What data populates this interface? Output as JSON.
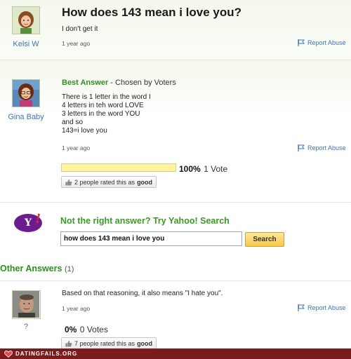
{
  "question": {
    "user": "Kelsi W",
    "title": "How does 143 mean i love you?",
    "body": "I don't get it",
    "time": "1 year ago",
    "report": "Report Abuse"
  },
  "best_answer": {
    "user": "Gina Baby",
    "label": "Best Answer",
    "chosen_by": " - Chosen by Voters",
    "lines": [
      "There is 1 letter in the word I",
      "4 letters in teh word LOVE",
      "3 letters in the word YOU",
      "and so",
      "143=i love you"
    ],
    "time": "1 year ago",
    "report": "Report Abuse",
    "vote_pct": "100%",
    "vote_fraction": 1.0,
    "vote_count": "1 Vote",
    "rated_prefix": "2 people rated this as",
    "rated_word": "good"
  },
  "yahoo": {
    "logo_text": "Y",
    "bang": "!",
    "prompt": "Not the right answer? Try Yahoo! Search",
    "search_value": "how does 143 mean i love you",
    "search_button": "Search"
  },
  "other_answers": {
    "heading": "Other Answers",
    "count": "(1)",
    "items": [
      {
        "user": "?",
        "body": "Based on that reasoning, it also means \"I hate you\".",
        "time": "1 year ago",
        "report": "Report Abuse",
        "vote_pct": "0%",
        "vote_count": "0 Votes",
        "rated_prefix": "7 people rated this as",
        "rated_word": "good"
      }
    ]
  },
  "footer": {
    "text": "DATINGFAILS.ORG"
  },
  "colors": {
    "link": "#3e73b8",
    "green": "#2f8f1f",
    "yahoo_purple": "#6b1d90",
    "footer_bg": "#7a1c1c"
  },
  "icons": {
    "report": "flag-icon",
    "rated": "thumbs-up-icon",
    "footer": "heart-icon"
  }
}
